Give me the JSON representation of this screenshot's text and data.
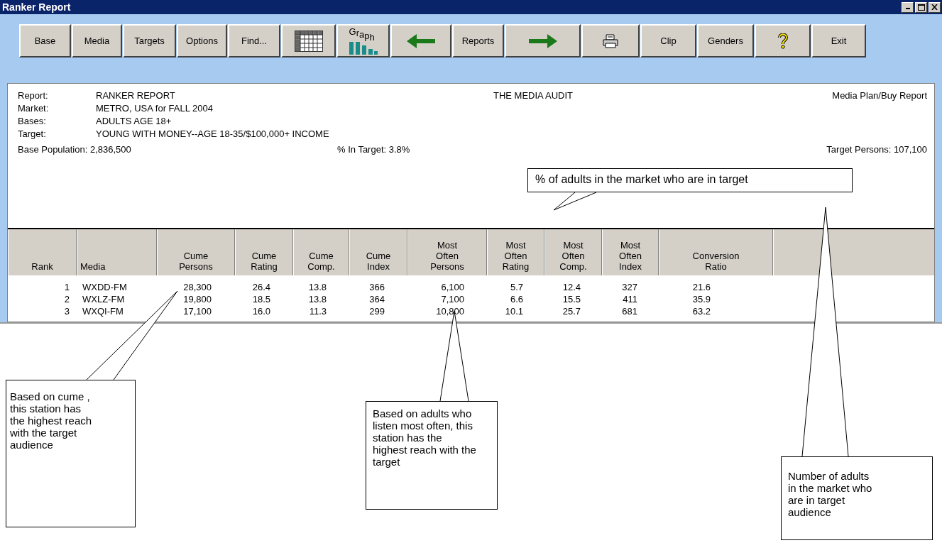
{
  "window": {
    "title": "Ranker Report"
  },
  "toolbar": {
    "buttons": [
      {
        "kind": "text",
        "label": "Base"
      },
      {
        "kind": "text",
        "label": "Media"
      },
      {
        "kind": "text",
        "label": "Targets"
      },
      {
        "kind": "text",
        "label": "Options"
      },
      {
        "kind": "text",
        "label": "Find..."
      },
      {
        "kind": "table"
      },
      {
        "kind": "graph",
        "label": "Graph"
      },
      {
        "kind": "back"
      },
      {
        "kind": "text",
        "label": "Reports"
      },
      {
        "kind": "forward"
      },
      {
        "kind": "print"
      },
      {
        "kind": "text",
        "label": "Clip"
      },
      {
        "kind": "text",
        "label": "Genders"
      },
      {
        "kind": "help"
      },
      {
        "kind": "text",
        "label": "Exit"
      }
    ]
  },
  "report_header": {
    "fields": [
      {
        "label": "Report:",
        "value": "RANKER REPORT"
      },
      {
        "label": "Market:",
        "value": "METRO, USA for FALL 2004"
      },
      {
        "label": "Bases:",
        "value": "ADULTS AGE 18+"
      },
      {
        "label": "Target:",
        "value": "YOUNG WITH MONEY--AGE 18-35/$100,000+ INCOME"
      }
    ],
    "source": "THE MEDIA AUDIT",
    "report_type": "Media Plan/Buy Report",
    "base_population": "Base Population: 2,836,500",
    "percent_in_target": "% In Target: 3.8%",
    "target_persons": "Target Persons: 107,100"
  },
  "table": {
    "columns": [
      "Rank",
      "Media",
      "Cume\nPersons",
      "Cume\nRating",
      "Cume\nComp.",
      "Cume\nIndex",
      "Most\nOften\nPersons",
      "Most\nOften\nRating",
      "Most\nOften\nComp.",
      "Most\nOften\nIndex",
      "Conversion\nRatio"
    ],
    "rows": [
      [
        "1",
        "WXDD-FM",
        "28,300",
        "26.4",
        "13.8",
        "366",
        "6,100",
        "5.7",
        "12.4",
        "327",
        "21.6"
      ],
      [
        "2",
        "WXLZ-FM",
        "19,800",
        "18.5",
        "13.8",
        "364",
        "7,100",
        "6.6",
        "15.5",
        "411",
        "35.9"
      ],
      [
        "3",
        "WXQI-FM",
        "17,100",
        "16.0",
        "11.3",
        "299",
        "10,800",
        "10.1",
        "25.7",
        "681",
        "63.2"
      ]
    ]
  },
  "callouts": [
    {
      "text": "% of adults in the market who are in target"
    },
    {
      "text": "Based on cume , this station has the highest reach with the target audience"
    },
    {
      "text": "Based on adults who listen most often, this station has the highest reach with the target"
    },
    {
      "text": "Number of adults in the market who are in target audience"
    }
  ]
}
